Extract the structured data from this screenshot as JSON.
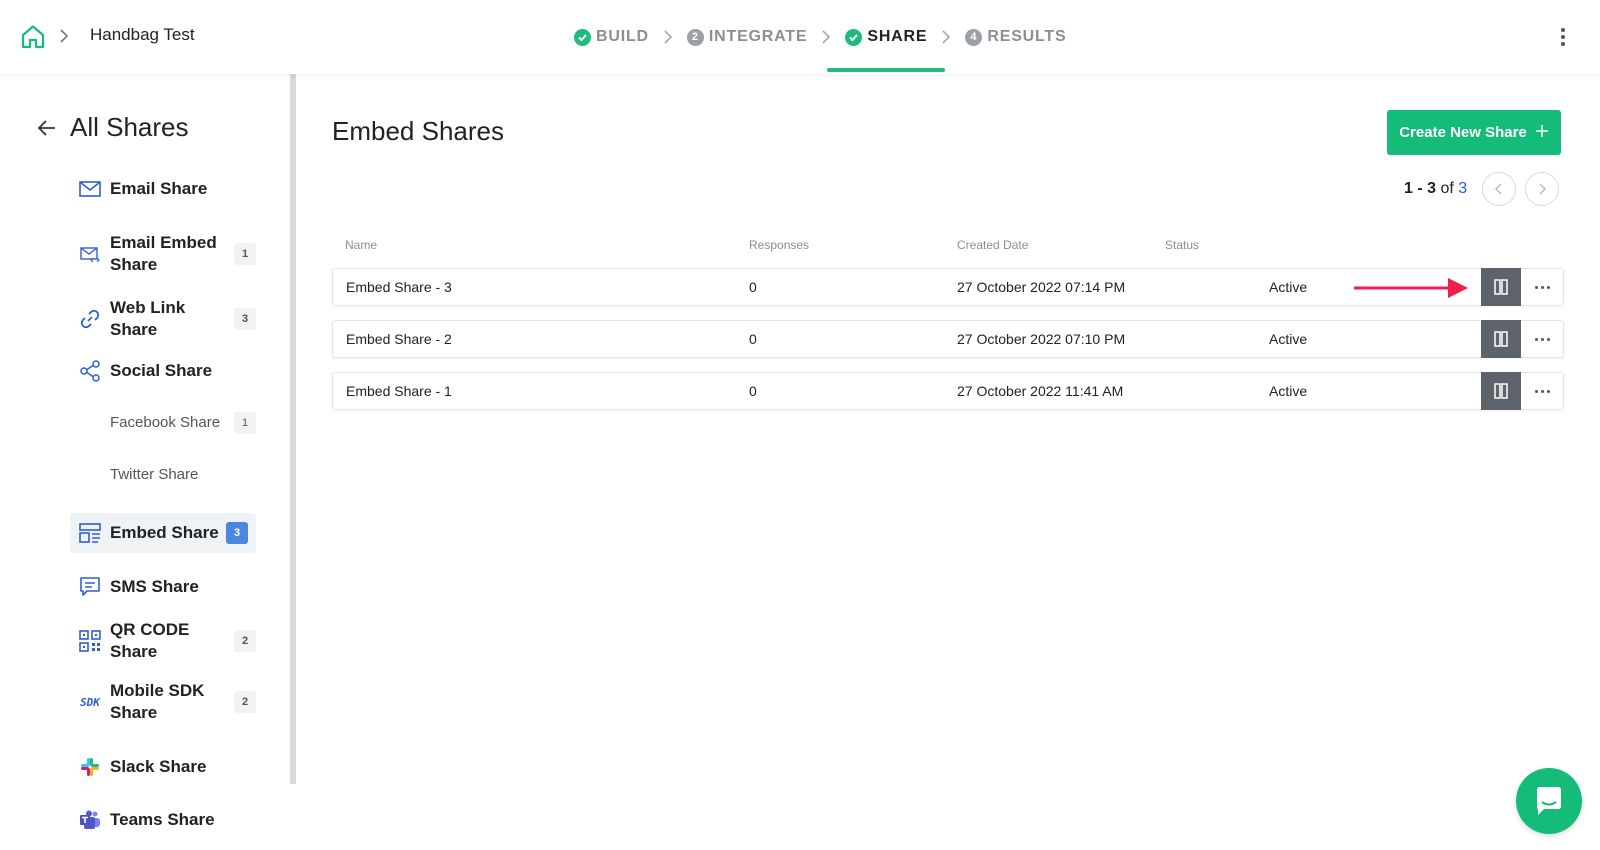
{
  "topbar": {
    "project": "Handbag Test",
    "steps": [
      {
        "num": "",
        "label": "BUILD",
        "state": "done"
      },
      {
        "num": "2",
        "label": "INTEGRATE",
        "state": "pending"
      },
      {
        "num": "",
        "label": "SHARE",
        "state": "active"
      },
      {
        "num": "4",
        "label": "RESULTS",
        "state": "pending"
      }
    ]
  },
  "sidebar": {
    "title": "All Shares",
    "items": [
      {
        "label": "Email Share",
        "badge": "",
        "icon": "mail-icon"
      },
      {
        "label": "Email Embed Share",
        "badge": "1",
        "icon": "mail-code-icon"
      },
      {
        "label": "Web Link Share",
        "badge": "3",
        "icon": "link-icon"
      },
      {
        "label": "Social Share",
        "badge": "",
        "icon": "share-nodes-icon"
      },
      {
        "label": "Facebook Share",
        "badge": "1",
        "icon": ""
      },
      {
        "label": "Twitter Share",
        "badge": "",
        "icon": ""
      },
      {
        "label": "Embed Share",
        "badge": "3",
        "icon": "embed-layout-icon"
      },
      {
        "label": "SMS Share",
        "badge": "",
        "icon": "message-icon"
      },
      {
        "label": "QR CODE Share",
        "badge": "2",
        "icon": "qr-code-icon"
      },
      {
        "label": "Mobile SDK Share",
        "badge": "2",
        "icon": "sdk-icon"
      },
      {
        "label": "Slack Share",
        "badge": "",
        "icon": "slack-icon"
      },
      {
        "label": "Teams Share",
        "badge": "",
        "icon": "teams-icon"
      }
    ]
  },
  "main": {
    "title": "Embed Shares",
    "create_label": "Create New Share",
    "pager": {
      "range": "1 - 3",
      "of": "of",
      "total": "3"
    },
    "columns": {
      "name": "Name",
      "responses": "Responses",
      "created": "Created Date",
      "status": "Status"
    },
    "rows": [
      {
        "name": "Embed Share - 3",
        "responses": "0",
        "created": "27 October 2022 07:14 PM",
        "status": "Active"
      },
      {
        "name": "Embed Share - 2",
        "responses": "0",
        "created": "27 October 2022 07:10 PM",
        "status": "Active"
      },
      {
        "name": "Embed Share - 1",
        "responses": "0",
        "created": "27 October 2022 11:41 AM",
        "status": "Active"
      }
    ]
  },
  "colors": {
    "accent": "#14bb79",
    "arrow": "#ee1f4f",
    "link": "#2563d9",
    "dark_button": "#5c636a"
  }
}
